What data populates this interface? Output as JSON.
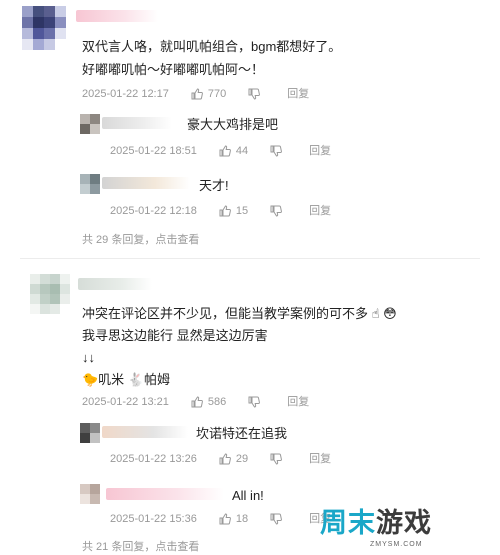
{
  "comments": [
    {
      "text_lines": [
        "双代言人咯，就叫叽帕组合，bgm都想好了。",
        "好嘟嘟叽帕～好嘟嘟叽帕阿～！"
      ],
      "date": "2025-01-22 12:17",
      "likes": "770",
      "reply_label": "回复",
      "replies": [
        {
          "text": "豪大大鸡排是吧",
          "date": "2025-01-22 18:51",
          "likes": "44",
          "reply_label": "回复"
        },
        {
          "text": "天才!",
          "date": "2025-01-22 12:18",
          "likes": "15",
          "reply_label": "回复"
        }
      ],
      "replies_summary": "共 29 条回复，点击查看"
    },
    {
      "text_lines": [
        "冲突在评论区并不少见，但能当教学案例的可不多 ☝ 😳",
        "我寻思这边能行 显然是这边厉害",
        "↓↓",
        "🐤叽米 🐇帕姆"
      ],
      "date": "2025-01-22 13:21",
      "likes": "586",
      "reply_label": "回复",
      "replies": [
        {
          "text": "坎诺特还在追我",
          "date": "2025-01-22 13:26",
          "likes": "29",
          "reply_label": "回复"
        },
        {
          "text": "All in!",
          "date": "2025-01-22 15:36",
          "likes": "18",
          "reply_label": "回复"
        }
      ],
      "replies_summary": "共 21 条回复，点击查看"
    }
  ],
  "watermark": {
    "brand_a": "周末",
    "brand_b": "游戏",
    "url": "ZMYSM.COM",
    "accent_color": "#1aa7c8"
  },
  "icons": {
    "like": "thumbs-up-icon",
    "dislike": "thumbs-down-icon"
  }
}
